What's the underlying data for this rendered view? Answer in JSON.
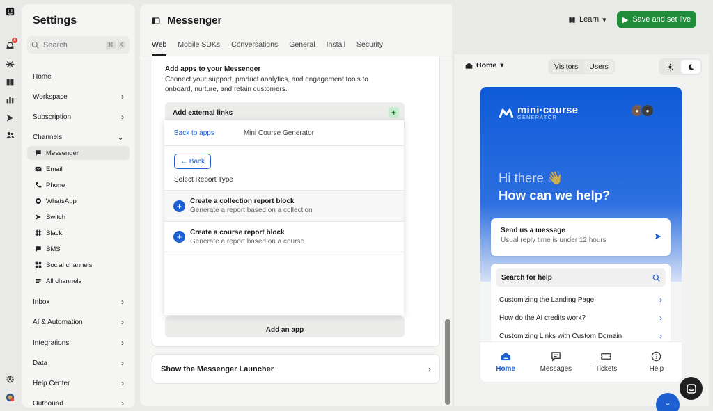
{
  "settings": {
    "title": "Settings",
    "search_placeholder": "Search",
    "kbd1": "⌘",
    "kbd2": "K",
    "items": {
      "home": "Home",
      "workspace": "Workspace",
      "subscription": "Subscription",
      "channels": "Channels",
      "messenger": "Messenger",
      "email": "Email",
      "phone": "Phone",
      "whatsapp": "WhatsApp",
      "switch": "Switch",
      "slack": "Slack",
      "sms": "SMS",
      "social": "Social channels",
      "all_channels": "All channels",
      "inbox": "Inbox",
      "ai": "AI & Automation",
      "integrations": "Integrations",
      "data": "Data",
      "help_center": "Help Center",
      "outbound": "Outbound"
    }
  },
  "rail": {
    "badge_count": "8"
  },
  "header": {
    "title": "Messenger",
    "learn_label": "Learn",
    "save_label": "Save and set live",
    "tabs": [
      "Web",
      "Mobile SDKs",
      "Conversations",
      "General",
      "Install",
      "Security"
    ]
  },
  "apps_card": {
    "heading": "Add apps to your Messenger",
    "description": "Connect your support, product analytics, and engagement tools to onboard, nurture, and retain customers.",
    "external_links": "Add external links",
    "add_app": "Add an app"
  },
  "launcher": {
    "label": "Show the Messenger Launcher"
  },
  "modal": {
    "back_to_apps": "Back to apps",
    "app_name": "Mini Course Generator",
    "back_button": "← Back",
    "section_title": "Select Report Type",
    "options": [
      {
        "title": "Create a collection report block",
        "subtitle": "Generate a report based on a collection"
      },
      {
        "title": "Create a course report block",
        "subtitle": "Generate a report based on a course"
      }
    ]
  },
  "preview": {
    "home_select": "Home",
    "segment": [
      "Visitors",
      "Users"
    ],
    "brand_line1": "mini·course",
    "brand_line2": "GENERATOR",
    "greeting1": "Hi there 👋",
    "greeting2": "How can we help?",
    "send_title": "Send us a message",
    "send_sub": "Usual reply time is under 12 hours",
    "help_search": "Search for help",
    "help_items": [
      "Customizing the Landing Page",
      "How do the AI credits work?",
      "Customizing Links with Custom Domain"
    ],
    "nav": [
      "Home",
      "Messages",
      "Tickets",
      "Help"
    ]
  },
  "colors": {
    "accent": "#1d5fd1",
    "save_green": "#1e8c3a"
  }
}
